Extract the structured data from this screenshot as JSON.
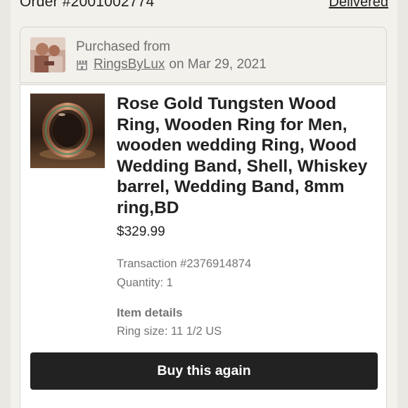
{
  "order": {
    "number": "Order #2001002774",
    "status": "Delivered"
  },
  "purchase": {
    "label": "Purchased from",
    "shop_name": "RingsByLux",
    "date_text": "on Mar 29, 2021",
    "shop_icon": "shop-icon"
  },
  "item": {
    "title": "Rose Gold Tungsten Wood Ring, Wooden Ring for Men, wooden wedding Ring, Wood Wedding Band, Shell, Whiskey barrel, Wedding Band, 8mm ring,BD",
    "price": "$329.99",
    "transaction": "Transaction #2376914874",
    "quantity": "Quantity: 1",
    "details_heading": "Item details",
    "ring_size": "Ring size: 11 1/2 US"
  },
  "actions": {
    "buy_again_label": "Buy this again"
  },
  "colors": {
    "background": "#f2f1ec",
    "card": "#ffffff",
    "primary_button": "#222222",
    "muted_text": "#757575"
  }
}
